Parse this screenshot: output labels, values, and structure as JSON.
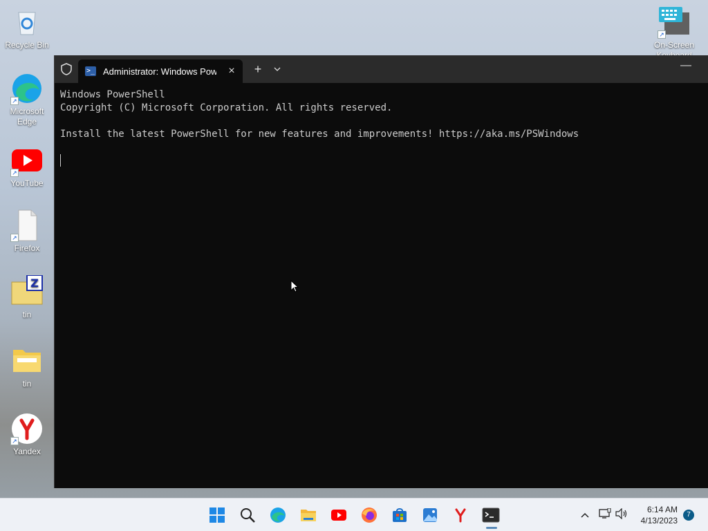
{
  "desktop": {
    "icons": [
      {
        "label": "Recycle Bin",
        "icon": "recycle-bin-icon"
      },
      {
        "label": "Microsoft Edge",
        "icon": "edge-icon"
      },
      {
        "label": "YouTube",
        "icon": "youtube-icon"
      },
      {
        "label": "Firefox",
        "icon": "blank-file-icon"
      },
      {
        "label": "tin",
        "icon": "winzip-folder-icon"
      },
      {
        "label": "tin",
        "icon": "folder-icon"
      },
      {
        "label": "Yandex",
        "icon": "yandex-icon"
      },
      {
        "label": "On-Screen Keyboard",
        "icon": "keyboard-icon"
      }
    ]
  },
  "terminal": {
    "tab_title": "Administrator: Windows PowerShell",
    "tab_close": "×",
    "new_tab": "+",
    "dropdown": "⌄",
    "minimize": "—",
    "lines": [
      "Windows PowerShell",
      "Copyright (C) Microsoft Corporation. All rights reserved.",
      "",
      "Install the latest PowerShell for new features and improvements! https://aka.ms/PSWindows"
    ]
  },
  "taskbar": {
    "apps": [
      "start-icon",
      "search-icon",
      "edge-icon",
      "file-explorer-icon",
      "youtube-icon",
      "firefox-icon",
      "store-icon",
      "photos-icon",
      "yandex-icon",
      "terminal-icon"
    ],
    "tray": {
      "time": "6:14 AM",
      "date": "4/13/2023",
      "notification_count": "7"
    }
  }
}
